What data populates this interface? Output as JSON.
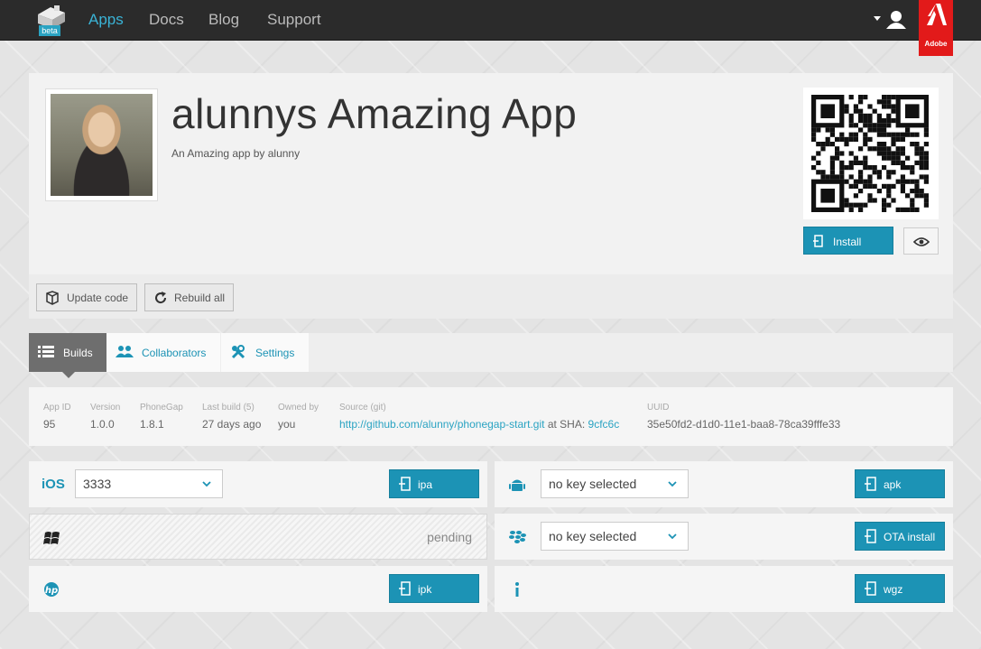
{
  "nav": {
    "beta_label": "beta",
    "items": [
      "Apps",
      "Docs",
      "Blog",
      "Support"
    ],
    "active": "Apps",
    "adobe_label": "Adobe"
  },
  "app": {
    "title": "alunnys Amazing App",
    "subtitle": "An Amazing app by alunny",
    "install_label": "Install"
  },
  "actions": {
    "update_code": "Update code",
    "rebuild_all": "Rebuild all"
  },
  "tabs": [
    "Builds",
    "Collaborators",
    "Settings"
  ],
  "info": {
    "app_id_label": "App ID",
    "app_id": "95",
    "version_label": "Version",
    "version": "1.0.0",
    "phonegap_label": "PhoneGap",
    "phonegap": "1.8.1",
    "last_build_label": "Last build (5)",
    "last_build": "27 days ago",
    "owned_by_label": "Owned by",
    "owned_by": "you",
    "source_label": "Source (git)",
    "source_url": "http://github.com/alunny/phonegap-start.git",
    "sha_text": "at SHA:",
    "sha": "9cfc6c",
    "uuid_label": "UUID",
    "uuid": "35e50fd2-d1d0-11e1-baa8-78ca39fffe33"
  },
  "platforms": {
    "ios": {
      "name": "iOS",
      "key": "3333",
      "button": "ipa"
    },
    "android": {
      "key": "no key selected",
      "button": "apk"
    },
    "windows": {
      "status": "pending"
    },
    "blackberry": {
      "key": "no key selected",
      "button": "OTA install"
    },
    "webos": {
      "button": "ipk"
    },
    "symbian": {
      "button": "wgz"
    }
  },
  "colors": {
    "accent": "#1c93b5",
    "nav_active": "#3ab3d6",
    "adobe_red": "#e21a1a"
  }
}
